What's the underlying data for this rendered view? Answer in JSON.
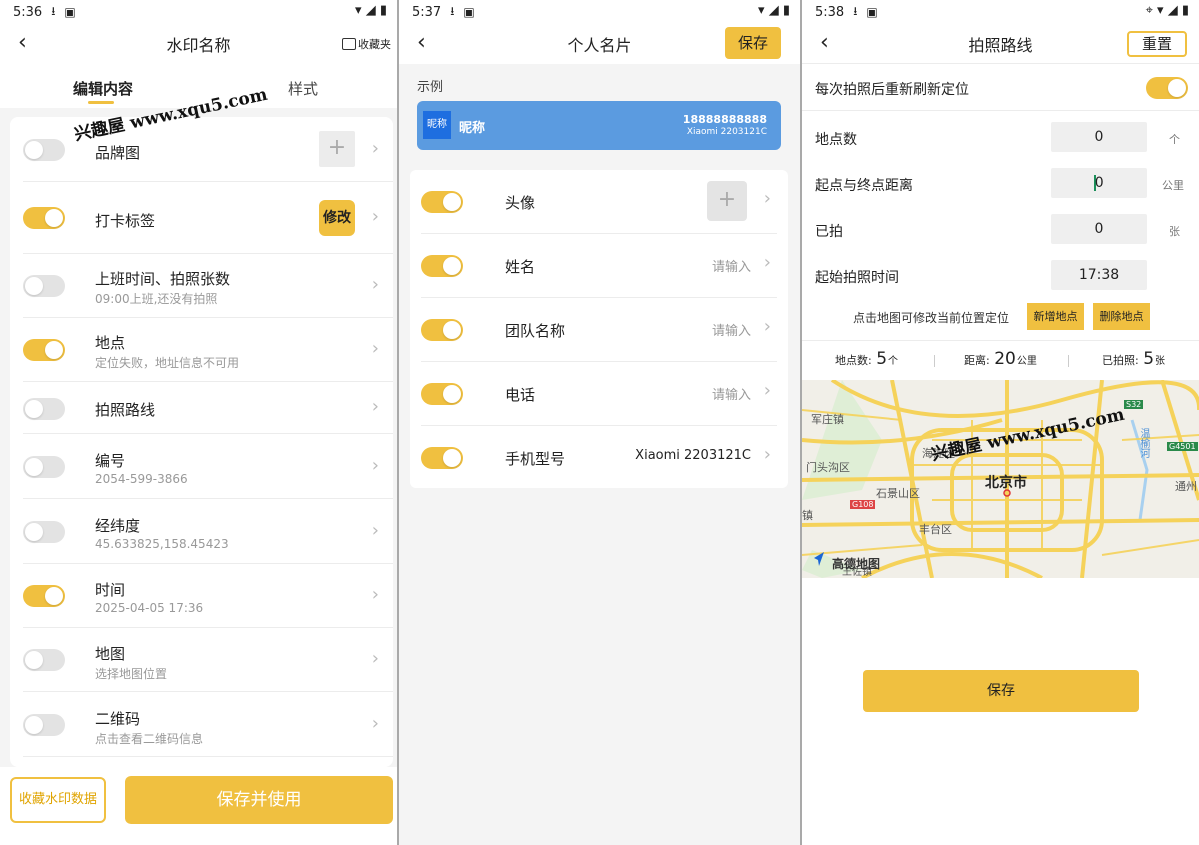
{
  "colors": {
    "accent": "#f0c040",
    "card_blue": "#5b9be0"
  },
  "panel1": {
    "status_time": "5:36",
    "title": "水印名称",
    "favorites_label": "收藏夹",
    "tabs": [
      "编辑内容",
      "样式"
    ],
    "watermark": "兴趣屋 www.xqu5.com",
    "edit_badge": "修改",
    "rows": [
      {
        "label": "品牌图",
        "sub": "",
        "on": false
      },
      {
        "label": "打卡标签",
        "sub": "",
        "on": true
      },
      {
        "label": "上班时间、拍照张数",
        "sub": "09:00上班,还没有拍照",
        "on": false
      },
      {
        "label": "地点",
        "sub": "定位失败，地址信息不可用",
        "on": true
      },
      {
        "label": "拍照路线",
        "sub": "",
        "on": false
      },
      {
        "label": "编号",
        "sub": "2054-599-3866",
        "on": false
      },
      {
        "label": "经纬度",
        "sub": "45.633825,158.45423",
        "on": false
      },
      {
        "label": "时间",
        "sub": "2025-04-05 17:36",
        "on": true
      },
      {
        "label": "地图",
        "sub": "选择地图位置",
        "on": false
      },
      {
        "label": "二维码",
        "sub": "点击查看二维码信息",
        "on": false
      }
    ],
    "fav_button": "收藏水印数据",
    "save_use_button": "保存并使用"
  },
  "panel2": {
    "status_time": "5:37",
    "title": "个人名片",
    "save_button": "保存",
    "example_label": "示例",
    "card": {
      "avatar_text": "昵称",
      "nickname": "昵称",
      "phone": "18888888888",
      "model": "Xiaomi 2203121C"
    },
    "rows": [
      {
        "label": "头像",
        "value": "",
        "on": true
      },
      {
        "label": "姓名",
        "value": "请输入",
        "on": true
      },
      {
        "label": "团队名称",
        "value": "请输入",
        "on": true
      },
      {
        "label": "电话",
        "value": "请输入",
        "on": true
      },
      {
        "label": "手机型号",
        "value": "Xiaomi 2203121C",
        "on": true
      }
    ]
  },
  "panel3": {
    "status_time": "5:38",
    "title": "拍照路线",
    "reset_button": "重置",
    "refresh_label": "每次拍照后重新刷新定位",
    "refresh_on": true,
    "fields": [
      {
        "label": "地点数",
        "value": "0",
        "unit": "个"
      },
      {
        "label": "起点与终点距离",
        "value": "0",
        "unit": "公里"
      },
      {
        "label": "已拍",
        "value": "0",
        "unit": "张"
      },
      {
        "label": "起始拍照时间",
        "value": "17:38",
        "unit": ""
      }
    ],
    "hint": "点击地图可修改当前位置定位",
    "add_button": "新增地点",
    "delete_button": "删除地点",
    "stats": {
      "points_label": "地点数:",
      "points_value": "5",
      "points_unit": "个",
      "distance_label": "距离:",
      "distance_value": "20",
      "distance_unit": "公里",
      "shot_label": "已拍照:",
      "shot_value": "5",
      "shot_unit": "张"
    },
    "map_labels": {
      "city": "北京市",
      "junzhuang": "军庄镇",
      "mentougou": "门头沟区",
      "haidian": "海淀区",
      "shijingshan": "石景山区",
      "fengtai": "丰台区",
      "zhen": "镇",
      "tongzhou": "通州",
      "wenyuhe": "温榆河",
      "road_g108": "G108",
      "road_g4501": "G4501",
      "road_s32": "S32",
      "brand": "高德地图",
      "wangzuo": "王佐镇"
    },
    "watermark": "兴趣屋 www.xqu5.com",
    "save_button": "保存"
  }
}
